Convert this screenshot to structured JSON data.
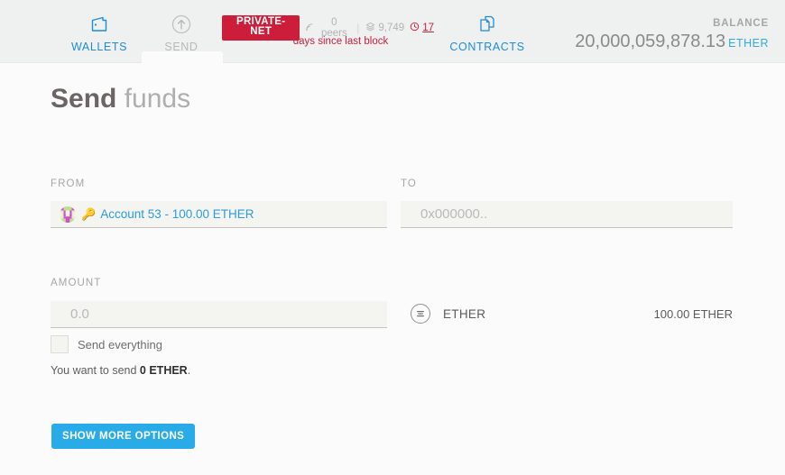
{
  "window": {
    "traffic_lights": [
      "close",
      "minimize",
      "maximize"
    ]
  },
  "header": {
    "nav": [
      {
        "id": "wallets",
        "label": "WALLETS",
        "icon": "wallet-icon",
        "active": false
      },
      {
        "id": "send",
        "label": "SEND",
        "icon": "send-arrow-icon",
        "active": true
      },
      {
        "id": "contracts",
        "label": "CONTRACTS",
        "icon": "contracts-icon",
        "active": false
      }
    ],
    "network": {
      "badge": "PRIVATE-NET",
      "badge_color": "#cc1d3a",
      "peers": "0 peers",
      "peers_icon": "signal-icon",
      "blocks": "9,749",
      "blocks_icon": "block-icon",
      "last_block_days": "17",
      "last_block_icon": "clock-icon",
      "divider": "|",
      "subtitle": "days since last block"
    },
    "balance": {
      "label": "BALANCE",
      "value": "20,000,059,878.13",
      "unit": "ETHER",
      "unit_color": "#35a8de"
    }
  },
  "page": {
    "title_strong": "Send",
    "title_light": "funds"
  },
  "form": {
    "from": {
      "label": "FROM",
      "account_text": "Account 53 - 100.00 ETHER",
      "key_icon": "key-icon",
      "avatar": "identicon-avatar"
    },
    "to": {
      "label": "TO",
      "value": "",
      "placeholder": "0x000000.."
    },
    "amount": {
      "label": "AMOUNT",
      "value": "",
      "placeholder": "0.0"
    },
    "send_everything": {
      "label": "Send everything",
      "checked": false
    },
    "summary_prefix": "You want to send ",
    "summary_value": "0 ETHER",
    "summary_suffix": ".",
    "token": {
      "icon": "ether-token-icon",
      "name": "ETHER",
      "amount": "100.00 ETHER"
    },
    "show_more_button": "SHOW MORE OPTIONS"
  }
}
